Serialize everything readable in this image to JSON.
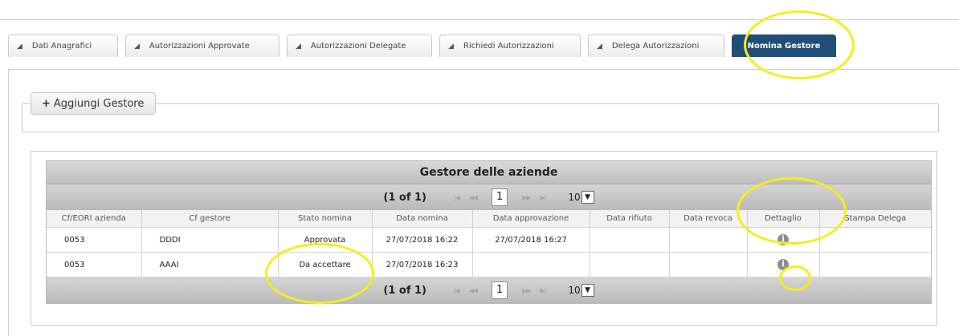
{
  "tabs": [
    {
      "label": "Dati Anagrafici"
    },
    {
      "label": "Autorizzazioni Approvate"
    },
    {
      "label": "Autorizzazioni Delegate"
    },
    {
      "label": "Richiedi Autorizzazioni"
    },
    {
      "label": "Delega Autorizzazioni"
    },
    {
      "label": "Nomina Gestore"
    }
  ],
  "add_button": {
    "label": "Aggiungi Gestore"
  },
  "grid": {
    "title": "Gestore delle aziende",
    "pager": {
      "count": "(1 of 1)",
      "page": "1",
      "rows_per_page": "10"
    },
    "columns": [
      "Cf/EORI azienda",
      "Cf gestore",
      "Stato nomina",
      "Data nomina",
      "Data approvazione",
      "Data rifiuto",
      "Data revoca",
      "Dettaglio",
      "Stampa Delega"
    ],
    "rows": [
      {
        "azienda": "0053",
        "gestore": "DDDI",
        "stato": "Approvata",
        "data_nomina": "27/07/2018 16:22",
        "data_approvazione": "27/07/2018 16:27",
        "data_rifiuto": "",
        "data_revoca": "",
        "stampa": ""
      },
      {
        "azienda": "0053",
        "gestore": "AAAI",
        "stato": "Da accettare",
        "data_nomina": "27/07/2018 16:23",
        "data_approvazione": "",
        "data_rifiuto": "",
        "data_revoca": "",
        "stampa": ""
      }
    ]
  },
  "colors": {
    "active_tab": "#1f4e79",
    "highlight": "#f6ec1b"
  }
}
